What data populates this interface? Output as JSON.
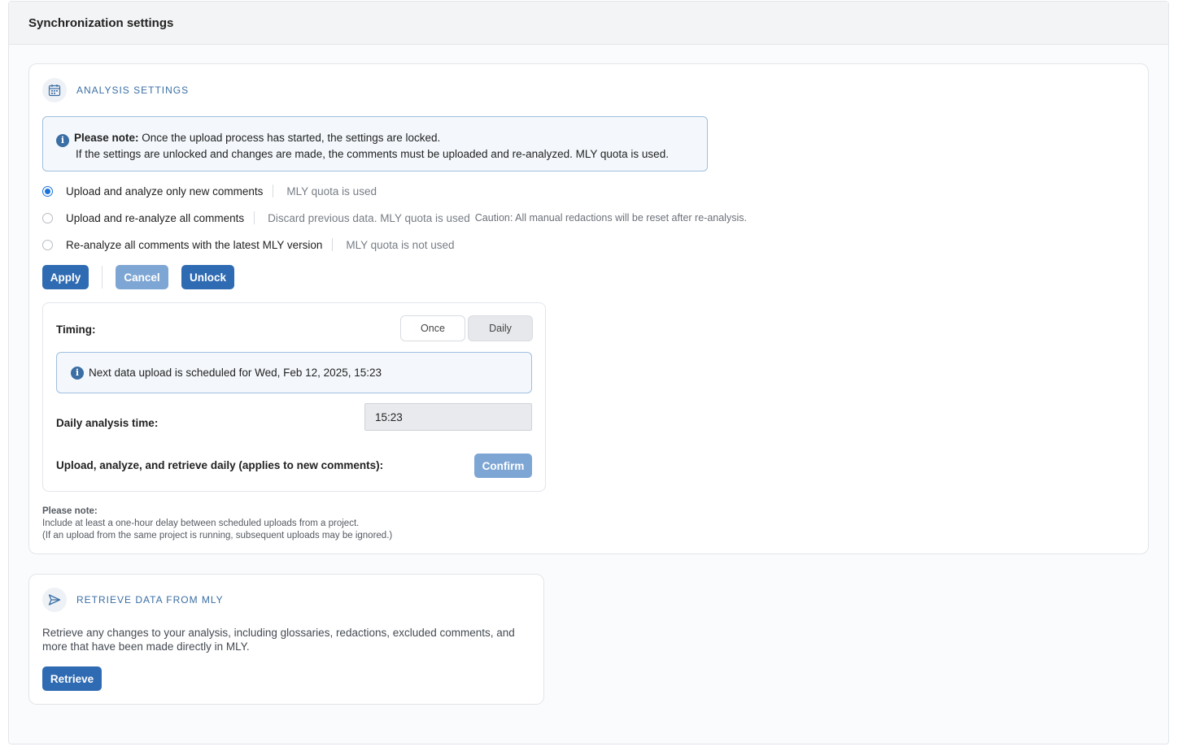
{
  "page": {
    "title": "Synchronization settings"
  },
  "analysis": {
    "section_title": "ANALYSIS SETTINGS",
    "section_icon": "calendar-icon",
    "notice": {
      "bold": "Please note:",
      "line1": " Once the upload process has started, the settings are locked.",
      "line2": "If the settings are unlocked and changes are made, the comments must be uploaded and re-analyzed. MLY quota is used."
    },
    "options": [
      {
        "label": "Upload and analyze only new comments",
        "hint": "MLY quota is used",
        "extra": "",
        "checked": true
      },
      {
        "label": "Upload and re-analyze all comments",
        "hint": "Discard previous data. MLY quota is used",
        "extra": "Caution: All manual redactions will be reset after re-analysis.",
        "checked": false
      },
      {
        "label": "Re-analyze all comments with the latest MLY version",
        "hint": "MLY quota is not used",
        "extra": "",
        "checked": false
      }
    ],
    "buttons": {
      "apply": "Apply",
      "cancel": "Cancel",
      "unlock": "Unlock"
    },
    "timing": {
      "label": "Timing:",
      "once": "Once",
      "daily": "Daily",
      "selected": "Daily",
      "schedule_text": "Next data upload is scheduled for Wed, Feb 12, 2025, 15:23",
      "daily_time_label": "Daily analysis time:",
      "daily_time_value": "15:23",
      "upload_label": "Upload, analyze, and retrieve daily (applies to new comments):",
      "confirm": "Confirm"
    },
    "footnote": {
      "title": "Please note:",
      "line1": "Include at least a one-hour delay between scheduled uploads from a project.",
      "line2": "(If an upload from the same project is running, subsequent uploads may be ignored.)"
    }
  },
  "retrieve": {
    "section_title": "RETRIEVE DATA FROM MLY",
    "section_icon": "send-icon",
    "description": "Retrieve any changes to your analysis, including glossaries, redactions, excluded comments, and more that have been made directly in MLY.",
    "button": "Retrieve"
  },
  "colors": {
    "primary": "#2f6bb3",
    "primary_disabled": "#7ea6d4",
    "accent_text": "#3a6ea5",
    "radio_selected": "#1a73d9"
  }
}
